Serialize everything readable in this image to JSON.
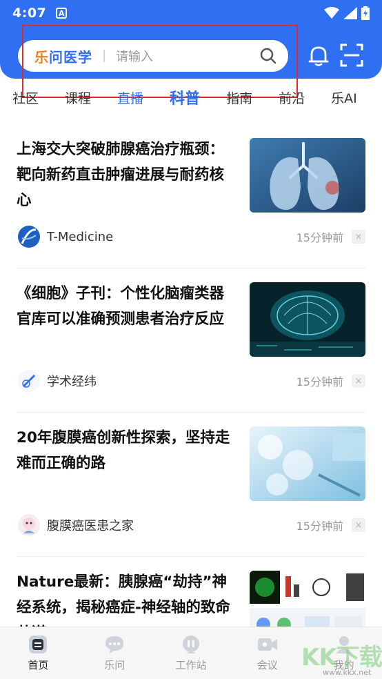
{
  "status": {
    "time": "4:07",
    "a_glyph": "A"
  },
  "header": {
    "brand": "乐问医学",
    "brand_first": "乐",
    "brand_rest": "问医学",
    "search_placeholder": "请输入"
  },
  "tabs": [
    {
      "label": "社区"
    },
    {
      "label": "课程"
    },
    {
      "label": "直播"
    },
    {
      "label": "科普"
    },
    {
      "label": "指南"
    },
    {
      "label": "前沿"
    },
    {
      "label": "乐AI"
    }
  ],
  "articles": [
    {
      "title": "上海交大突破肺腺癌治疗瓶颈：靶向新药直击肿瘤进展与耐药核心",
      "source": "T-Medicine",
      "time": "15分钟前",
      "close": "×"
    },
    {
      "title": "《细胞》子刊：个性化脑瘤类器官库可以准确预测患者治疗反应",
      "source": "学术经纬",
      "time": "15分钟前",
      "close": "×"
    },
    {
      "title": "20年腹膜癌创新性探索，坚持走难而正确的路",
      "source": "腹膜癌医患之家",
      "time": "15分钟前",
      "close": "×"
    },
    {
      "title": "Nature最新：胰腺癌“劫持”神经系统，揭秘癌症-神经轴的致命共谋",
      "source": "",
      "time": "",
      "close": ""
    }
  ],
  "bottom_nav": [
    {
      "label": "首页",
      "icon": "home-icon"
    },
    {
      "label": "乐问",
      "icon": "chat-icon"
    },
    {
      "label": "工作站",
      "icon": "workstation-icon"
    },
    {
      "label": "会议",
      "icon": "video-icon"
    },
    {
      "label": "我的",
      "icon": "profile-icon"
    }
  ],
  "watermark": {
    "text": "KK下载",
    "url": "www.kkx.net"
  },
  "colors": {
    "primary": "#2f6ff2",
    "brand_accent": "#ff7a1a",
    "highlight": "#e02a2a"
  }
}
